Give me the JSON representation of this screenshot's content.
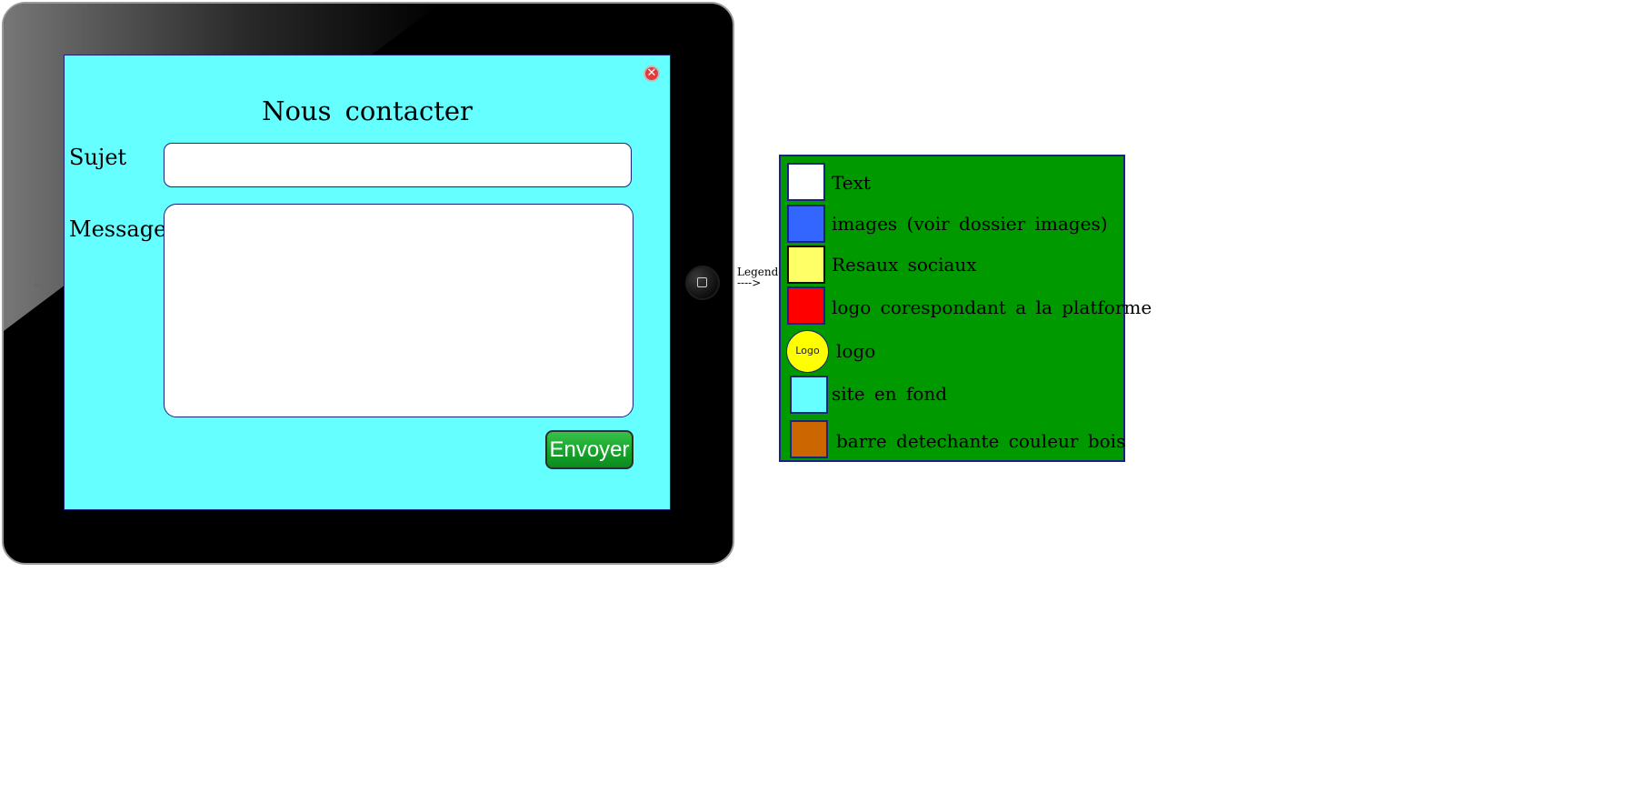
{
  "screen": {
    "close_symbol": "✕",
    "title": "Nous contacter",
    "subject_label": "Sujet",
    "subject_value": "",
    "message_label": "Message",
    "message_value": "",
    "send_label": "Envoyer"
  },
  "legend_pointer": {
    "line1": "Legende",
    "line2": "---->"
  },
  "legend": {
    "items": [
      {
        "label": "Text",
        "color": "#ffffff"
      },
      {
        "label": "images (voir dossier images)",
        "color": "#3366ff"
      },
      {
        "label": "Resaux sociaux",
        "color": "#ffff66"
      },
      {
        "label": "logo corespondant a la platforme",
        "color": "#ff0000"
      },
      {
        "label": "logo",
        "color": "#ffff00",
        "badge_text": "Logo"
      },
      {
        "label": "site en fond",
        "color": "#66ffff"
      },
      {
        "label": "barre detechante couleur bois",
        "color": "#cc6600"
      }
    ]
  },
  "colors": {
    "screen_background": "#66ffff",
    "legend_background": "#009900",
    "send_button": "#15a52a",
    "close_button": "#e23b3b"
  }
}
